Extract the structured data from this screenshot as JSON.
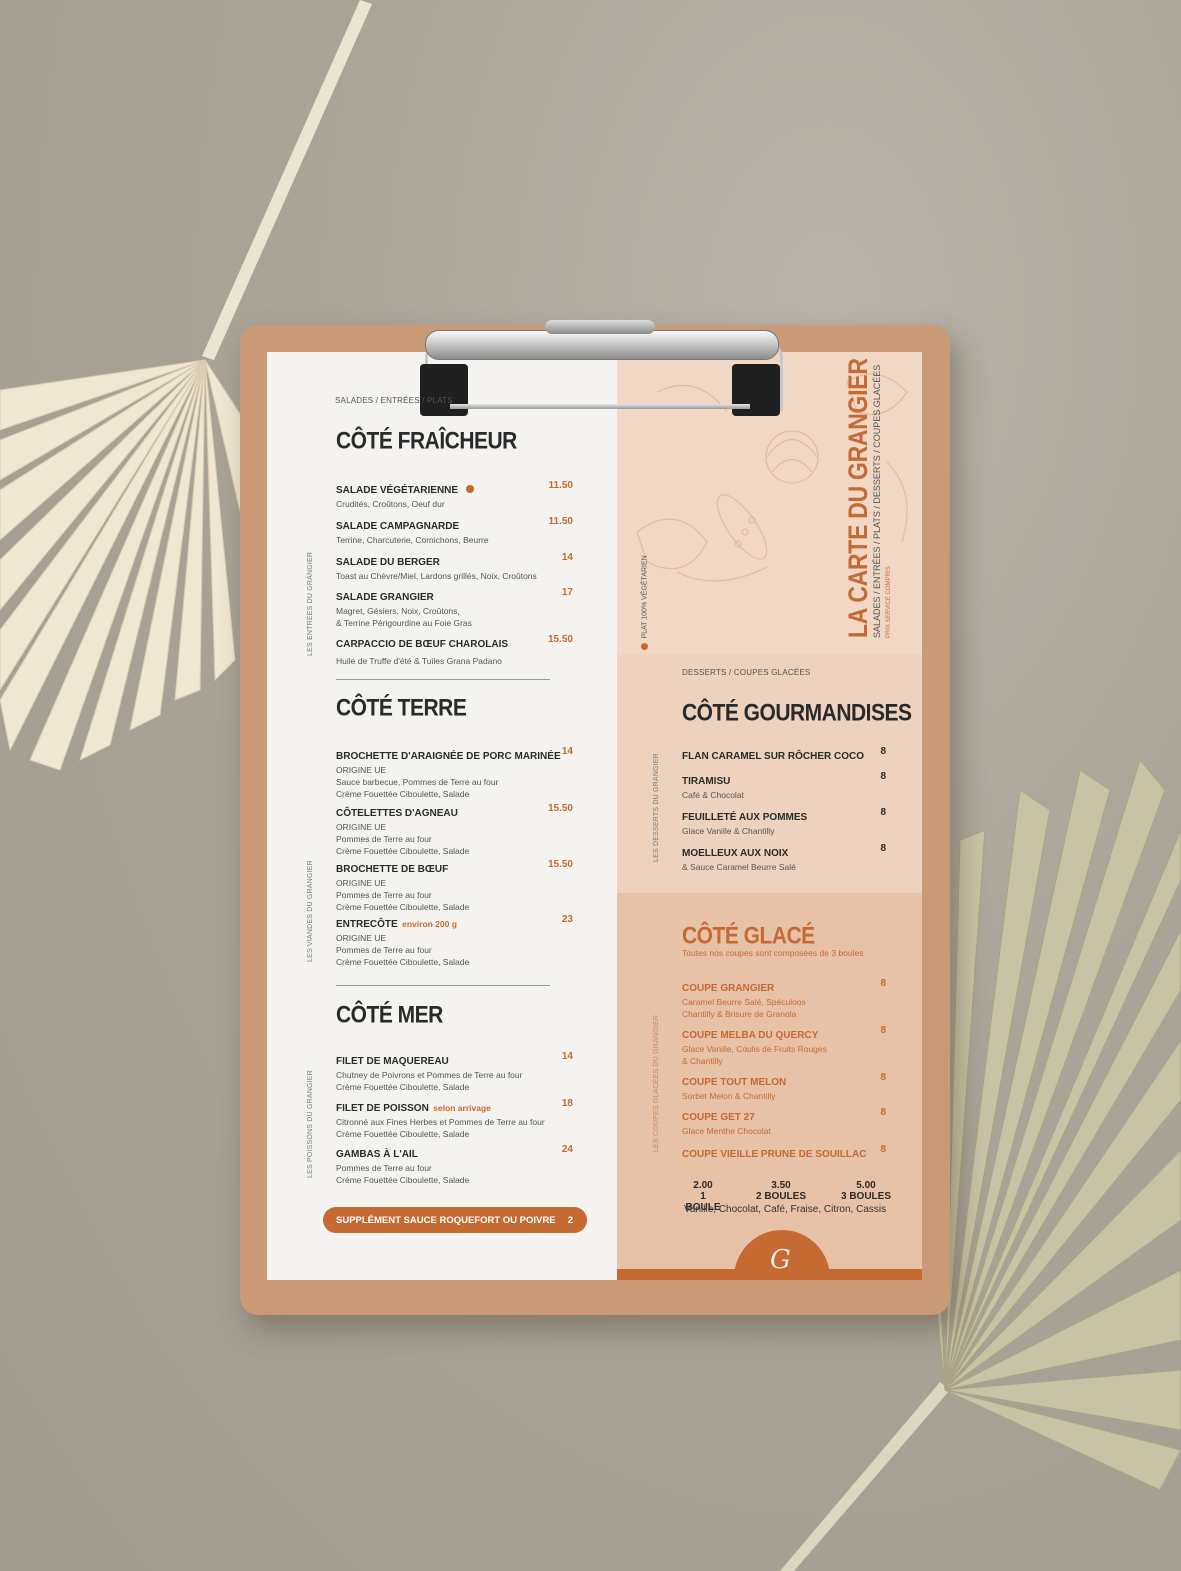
{
  "menu": {
    "title": "LA CARTE DU GRANGIER",
    "subtitle": "SALADES / ENTRÉES / PLATS / DESSERTS / COUPES GLACÉES",
    "prices_note": "PRIX SERVICE COMPRIS",
    "veg_note": "PLAT 100% VÉGÉTARIEN",
    "left_breadcrumb": "SALADES / ENTRÉES / PLATS"
  },
  "fraicheur": {
    "title": "CÔTÉ FRAÎCHEUR",
    "side_label": "LES ENTRÉES DU GRANGIER",
    "items": [
      {
        "name": "SALADE VÉGÉTARIENNE",
        "desc": "Crudités, Croûtons, Oeuf dur",
        "price": "11.50"
      },
      {
        "name": "SALADE CAMPAGNARDE",
        "desc": "Terrine, Charcuterie, Cornichons, Beurre",
        "price": "11.50"
      },
      {
        "name": "SALADE DU BERGER",
        "desc": "Toast au Chèvre/Miel, Lardons grillés, Noix, Croûtons",
        "price": "14"
      },
      {
        "name": "SALADE GRANGIER",
        "desc": "Magret, Gésiers, Noix, Croûtons,",
        "desc2": "& Terrine Périgourdine au Foie Gras",
        "price": "17"
      },
      {
        "name": "CARPACCIO DE BŒUF CHAROLAIS",
        "desc": "Huile de Truffe d'été & Tuiles Grana Padano",
        "price": "15.50"
      }
    ]
  },
  "terre": {
    "title": "CÔTÉ TERRE",
    "side_label": "LES VIANDES DU GRANGIER",
    "items": [
      {
        "name": "BROCHETTE D'ARAIGNÉE DE PORC MARINÉE",
        "origin": "ORIGINE UE",
        "desc": "Sauce barbecue, Pommes de Terre au four",
        "desc2": "Crème Fouettée Ciboulette, Salade",
        "price": "14"
      },
      {
        "name": "CÔTELETTES D'AGNEAU",
        "origin": "ORIGINE UE",
        "desc": "Pommes de Terre au four",
        "desc2": "Crème Fouettée Ciboulette, Salade",
        "price": "15.50"
      },
      {
        "name": "BROCHETTE DE BŒUF",
        "origin": "ORIGINE UE",
        "desc": "Pommes de Terre au four",
        "desc2": "Crème Fouettée Ciboulette, Salade",
        "price": "15.50"
      },
      {
        "name": "ENTRECÔTE",
        "extra": "environ 200 g",
        "origin": "ORIGINE UE",
        "desc": "Pommes de Terre au four",
        "desc2": "Crème Fouettée Ciboulette, Salade",
        "price": "23"
      }
    ]
  },
  "mer": {
    "title": "CÔTÉ MER",
    "side_label": "LES POISSONS DU GRANGIER",
    "items": [
      {
        "name": "FILET DE MAQUEREAU",
        "desc": "Chutney de Poivrons et Pommes de Terre au four",
        "desc2": "Crème Fouettée Ciboulette, Salade",
        "price": "14"
      },
      {
        "name": "FILET DE POISSON",
        "extra": "selon arrivage",
        "desc": "Citronné aux Fines Herbes et Pommes de Terre au four",
        "desc2": "Crème Fouettée Ciboulette, Salade",
        "price": "18"
      },
      {
        "name": "GAMBAS À L'AIL",
        "desc": "Pommes de Terre au four",
        "desc2": "Crème Fouettée Ciboulette, Salade",
        "price": "24"
      }
    ]
  },
  "supplement": {
    "label": "SUPPLÉMENT SAUCE ROQUEFORT OU POIVRE",
    "price": "2"
  },
  "gourmandises": {
    "breadcrumb": "DESSERTS / COUPES GLACÉES",
    "title": "CÔTÉ GOURMANDISES",
    "side_label": "LES DESSERTS DU GRANGIER",
    "items": [
      {
        "name": "FLAN CARAMEL SUR RÔCHER COCO",
        "desc": "",
        "price": "8"
      },
      {
        "name": "TIRAMISU",
        "desc": "Café & Chocolat",
        "price": "8"
      },
      {
        "name": "FEUILLETÉ AUX POMMES",
        "desc": "Glace Vanille & Chantilly",
        "price": "8"
      },
      {
        "name": "MOELLEUX AUX NOIX",
        "desc": "& Sauce Caramel Beurre Salé",
        "price": "8"
      }
    ]
  },
  "glace": {
    "title": "CÔTÉ GLACÉ",
    "subtitle": "Toutes nos coupes sont composées de 3 boules",
    "side_label": "LES COUPES GLACÉES DU GRANGIER",
    "items": [
      {
        "name": "COUPE GRANGIER",
        "desc": "Caramel Beurre Salé, Spéculoos",
        "desc2": "Chantilly & Brisure de Granola",
        "price": "8"
      },
      {
        "name": "COUPE MELBA DU QUERCY",
        "desc": "Glace Vanille, Coulis de Fruits Rouges",
        "desc2": "& Chantilly",
        "price": "8"
      },
      {
        "name": "COUPE TOUT MELON",
        "desc": "Sorbet Melon & Chantilly",
        "price": "8"
      },
      {
        "name": "COUPE GET 27",
        "desc": "Glace Menthe Chocolat",
        "price": "8"
      },
      {
        "name": "COUPE VIEILLE PRUNE DE SOUILLAC",
        "desc": "",
        "price": "8"
      }
    ],
    "scoops": [
      {
        "price": "2.00",
        "label": "1 BOULE"
      },
      {
        "price": "3.50",
        "label": "2 BOULES"
      },
      {
        "price": "5.00",
        "label": "3 BOULES"
      }
    ],
    "flavors": "Vanille, Chocolat, Café, Fraise, Citron, Cassis"
  },
  "logo_letter": "G",
  "colors": {
    "accent": "#c56a32",
    "text": "#2a2a2a",
    "paper": "#f4f3f0",
    "peach": "#f0d7c6"
  }
}
